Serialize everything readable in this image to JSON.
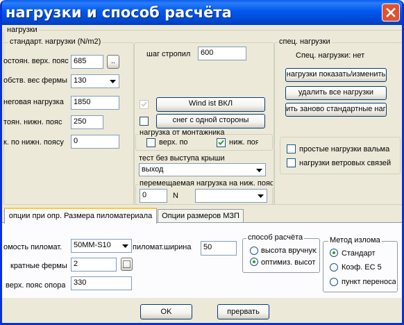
{
  "window": {
    "title": "нагрузки и способ расчёта"
  },
  "loads_group": {
    "label": "нагрузки"
  },
  "standard": {
    "label": "стандарт. нагрузки (N/m2)",
    "top_chord_label": "остоян. верх. пояс",
    "top_chord_value": "685",
    "top_chord_btn": "..",
    "self_weight_label": "обств. вес фермы",
    "self_weight_value": "130",
    "snow_label": "неговая нагрузка",
    "snow_value": "1850",
    "bottom_chord_label": "тоян. нижн. пояс",
    "bottom_chord_value": "250",
    "bottom_chord2_label": "к. по нижн. поясу",
    "bottom_chord2_value": "0"
  },
  "middle": {
    "rafter_step_label": "шаг стропил",
    "rafter_step_value": "600",
    "wind_btn": "Wind ist ВКЛ",
    "snow_side_btn": "снег с одной стороны",
    "mount_label": "нагрузка от монтажника",
    "mount_top": "верх. по",
    "mount_bottom": "ниж. пояс",
    "roof_test_label": "тест без выступа крыши",
    "roof_test_value": "выход",
    "moving_label": "перемещаемая нагрузка на ниж. поясе",
    "moving_value": "0",
    "moving_unit": "N",
    "moving_select": ""
  },
  "special": {
    "label": "спец. нагрузки",
    "status": "Спец. нагрузки: нет",
    "show_btn": "нагрузки показать/изменить",
    "delete_btn": "удалить все нагрузки",
    "reload_btn": "ить заново стандартные нагрузки",
    "simple_loads": "простые нагрузки вальма",
    "wind_links": "нагрузки ветровых связей"
  },
  "tabs": [
    {
      "label": "опции при опр. Размера пиломатериала"
    },
    {
      "label": "Опции размеров МЗП"
    }
  ],
  "options": {
    "lumber_label": "омость пиломат.",
    "lumber_value": "50MM-S10",
    "width_label": "пиломат.ширина",
    "width_value": "50",
    "multiple_label": "кратные фермы",
    "multiple_value": "2",
    "top_support_label": "верх. пояс опора",
    "top_support_value": "330"
  },
  "calc": {
    "label": "способ расчёта",
    "manual": "высота вручную",
    "optimized": "оптимиз. высот"
  },
  "fracture": {
    "label": "Метод излома",
    "standard": "Стандарт",
    "coef": "Коэф. EC 5",
    "point": "пункт переноса"
  },
  "footer": {
    "ok": "OK",
    "cancel": "прервать"
  }
}
